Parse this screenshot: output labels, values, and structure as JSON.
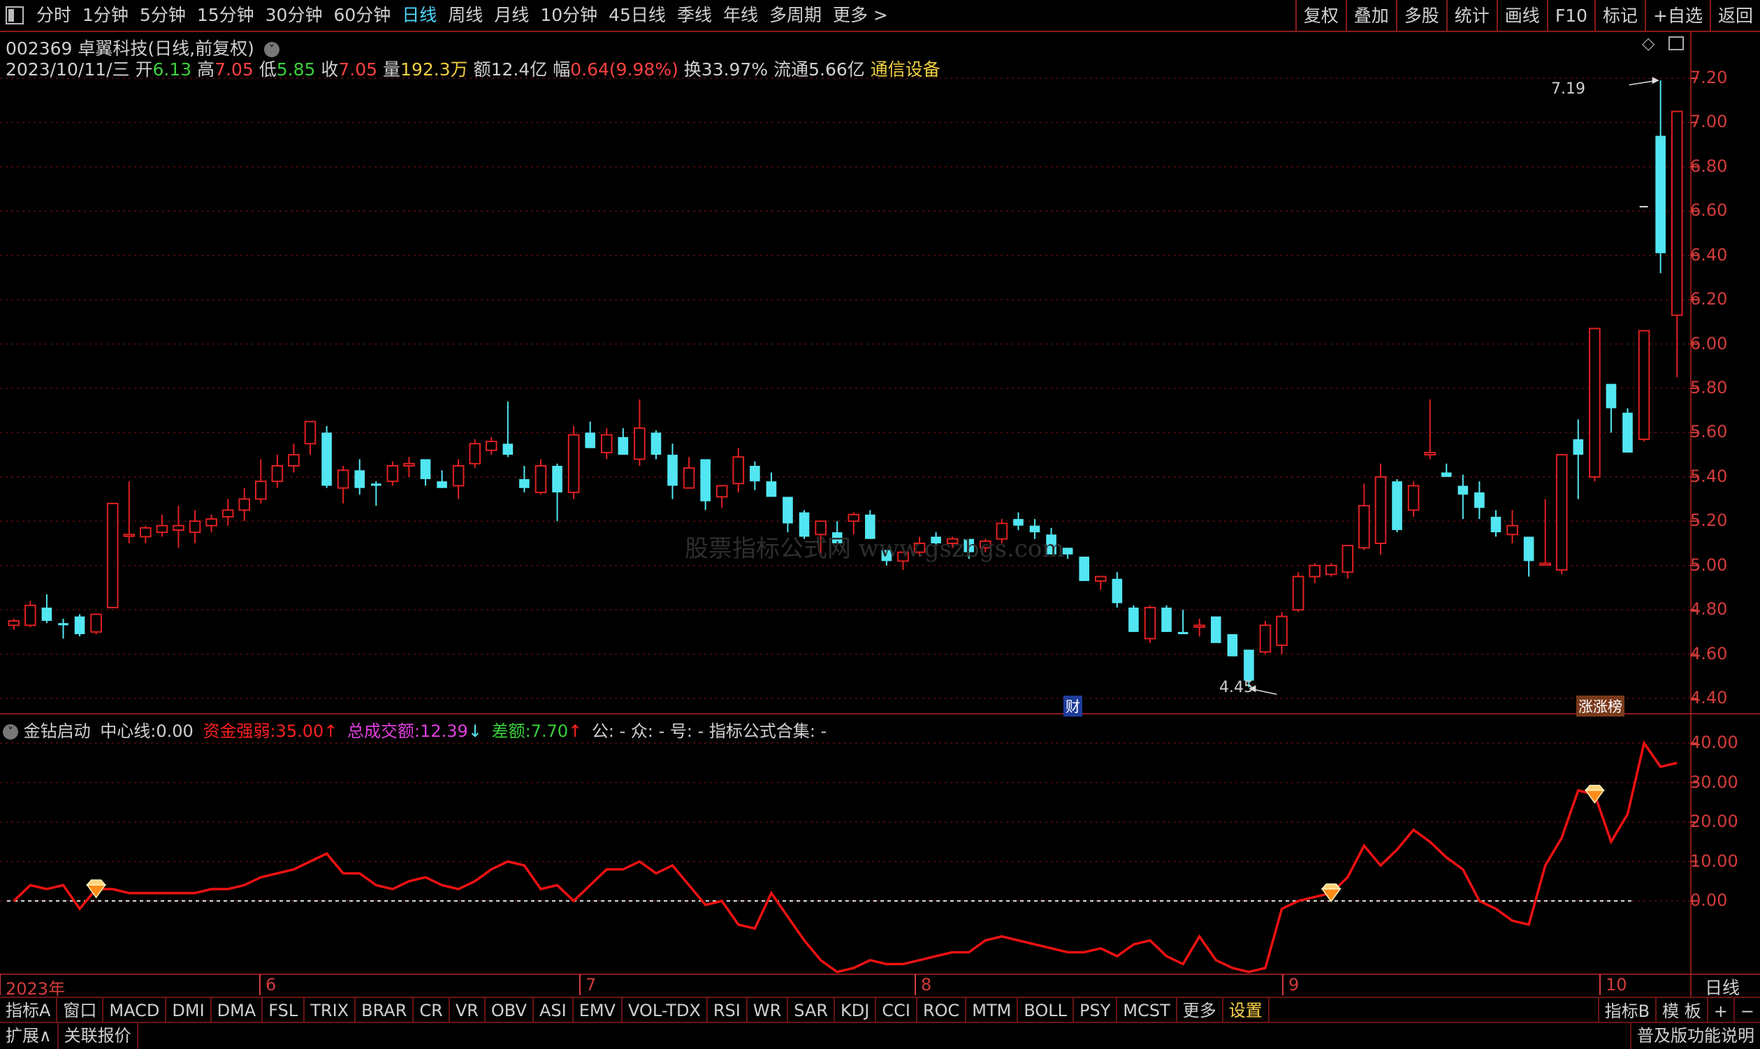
{
  "toolbar": {
    "periods": [
      "分时",
      "1分钟",
      "5分钟",
      "15分钟",
      "30分钟",
      "60分钟",
      "日线",
      "周线",
      "月线",
      "10分钟",
      "45日线",
      "季线",
      "年线",
      "多周期",
      "更多 >"
    ],
    "active": "日线",
    "right": [
      "复权",
      "叠加",
      "多股",
      "统计",
      "画线",
      "F10",
      "标记",
      "+自选",
      "返回"
    ]
  },
  "stock": {
    "title": "002369 卓翼科技(日线,前复权)",
    "date": "2023/10/11/三",
    "open_label": "开",
    "open": "6.13",
    "high_label": "高",
    "high": "7.05",
    "low_label": "低",
    "low": "5.85",
    "close_label": "收",
    "close": "7.05",
    "vol_label": "量",
    "vol": "192.3万",
    "amt_label": "额",
    "amt": "12.4亿",
    "chg_label": "幅",
    "chg": "0.64(9.98%)",
    "turn_label": "换",
    "turn": "33.97%",
    "float_label": "流通",
    "float": "5.66亿",
    "sector": "通信设备"
  },
  "price_axis": [
    "7.20",
    "7.00",
    "6.80",
    "6.60",
    "6.40",
    "6.20",
    "6.00",
    "5.80",
    "5.60",
    "5.40",
    "5.20",
    "5.00",
    "4.80",
    "4.60",
    "4.40"
  ],
  "annotations": {
    "max": "7.19",
    "min": "4.45",
    "cai": "财",
    "badge": "涨涨榜"
  },
  "watermark": "股票指标公式网 www.gszbgs.com",
  "indicator": {
    "name": "金钻启动",
    "center_label": "中心线:",
    "center": "0.00",
    "zjqr_label": "资金强弱:",
    "zjqr": "35.00",
    "zcje_label": "总成交额:",
    "zcje": "12.39",
    "ce_label": "差额:",
    "ce": "7.70",
    "tail": "公: -  众: -  号: -  指标公式合集: -"
  },
  "ind_axis": [
    "40.00",
    "30.00",
    "20.00",
    "10.00",
    "0.00"
  ],
  "time_axis": {
    "labels": [
      "2023年",
      "6",
      "7",
      "8",
      "9",
      "10"
    ],
    "right": "日线"
  },
  "tabs": [
    "指标A",
    "窗口",
    "MACD",
    "DMI",
    "DMA",
    "FSL",
    "TRIX",
    "BRAR",
    "CR",
    "VR",
    "OBV",
    "ASI",
    "EMV",
    "VOL-TDX",
    "RSI",
    "WR",
    "SAR",
    "KDJ",
    "CCI",
    "ROC",
    "MTM",
    "BOLL",
    "PSY",
    "MCST",
    "更多",
    "设置"
  ],
  "tabs_right": [
    "指标B",
    "模 板",
    "+",
    "−"
  ],
  "status": {
    "left": [
      "扩展∧",
      "关联报价"
    ],
    "right": "普及版功能说明"
  },
  "colors": {
    "up": "#e02020",
    "down": "#52e6f2",
    "grid": "#8a1a1a",
    "line": "#ee1111",
    "axis": "#d43b3b"
  },
  "chart_data": [
    {
      "type": "candlestick",
      "ylim": [
        4.4,
        7.2
      ],
      "candles": [
        [
          4.73,
          4.76,
          4.71,
          4.75
        ],
        [
          4.73,
          4.84,
          4.72,
          4.82
        ],
        [
          4.81,
          4.87,
          4.74,
          4.75
        ],
        [
          4.74,
          4.76,
          4.67,
          4.73
        ],
        [
          4.77,
          4.78,
          4.68,
          4.69
        ],
        [
          4.7,
          4.78,
          4.69,
          4.78
        ],
        [
          4.81,
          5.28,
          4.81,
          5.28
        ],
        [
          5.14,
          5.38,
          5.1,
          5.14
        ],
        [
          5.13,
          5.18,
          5.1,
          5.17
        ],
        [
          5.15,
          5.23,
          5.13,
          5.18
        ],
        [
          5.16,
          5.27,
          5.08,
          5.18
        ],
        [
          5.15,
          5.25,
          5.1,
          5.2
        ],
        [
          5.18,
          5.23,
          5.15,
          5.21
        ],
        [
          5.22,
          5.3,
          5.18,
          5.25
        ],
        [
          5.25,
          5.35,
          5.2,
          5.3
        ],
        [
          5.3,
          5.48,
          5.28,
          5.38
        ],
        [
          5.38,
          5.5,
          5.35,
          5.45
        ],
        [
          5.45,
          5.55,
          5.42,
          5.5
        ],
        [
          5.55,
          5.65,
          5.5,
          5.65
        ],
        [
          5.6,
          5.63,
          5.35,
          5.36
        ],
        [
          5.35,
          5.45,
          5.28,
          5.43
        ],
        [
          5.43,
          5.48,
          5.32,
          5.35
        ],
        [
          5.37,
          5.38,
          5.27,
          5.36
        ],
        [
          5.38,
          5.47,
          5.36,
          5.45
        ],
        [
          5.45,
          5.49,
          5.4,
          5.46
        ],
        [
          5.48,
          5.48,
          5.36,
          5.39
        ],
        [
          5.38,
          5.43,
          5.35,
          5.35
        ],
        [
          5.36,
          5.48,
          5.3,
          5.45
        ],
        [
          5.46,
          5.57,
          5.44,
          5.55
        ],
        [
          5.52,
          5.58,
          5.5,
          5.56
        ],
        [
          5.55,
          5.74,
          5.49,
          5.5
        ],
        [
          5.39,
          5.45,
          5.33,
          5.35
        ],
        [
          5.33,
          5.48,
          5.32,
          5.45
        ],
        [
          5.45,
          5.46,
          5.2,
          5.33
        ],
        [
          5.33,
          5.63,
          5.3,
          5.59
        ],
        [
          5.6,
          5.65,
          5.53,
          5.53
        ],
        [
          5.51,
          5.62,
          5.48,
          5.59
        ],
        [
          5.58,
          5.62,
          5.5,
          5.5
        ],
        [
          5.48,
          5.75,
          5.45,
          5.62
        ],
        [
          5.6,
          5.61,
          5.48,
          5.5
        ],
        [
          5.5,
          5.55,
          5.3,
          5.36
        ],
        [
          5.35,
          5.49,
          5.35,
          5.44
        ],
        [
          5.48,
          5.48,
          5.25,
          5.29
        ],
        [
          5.31,
          5.36,
          5.26,
          5.36
        ],
        [
          5.37,
          5.53,
          5.33,
          5.49
        ],
        [
          5.45,
          5.47,
          5.34,
          5.38
        ],
        [
          5.38,
          5.42,
          5.32,
          5.31
        ],
        [
          5.31,
          5.31,
          5.15,
          5.19
        ],
        [
          5.24,
          5.25,
          5.12,
          5.13
        ],
        [
          5.14,
          5.2,
          5.05,
          5.2
        ],
        [
          5.15,
          5.2,
          5.1,
          5.1
        ],
        [
          5.2,
          5.24,
          5.14,
          5.23
        ],
        [
          5.23,
          5.25,
          5.12,
          5.12
        ],
        [
          5.07,
          5.07,
          5.0,
          5.02
        ],
        [
          5.02,
          5.06,
          4.98,
          5.06
        ],
        [
          5.06,
          5.13,
          5.04,
          5.1
        ],
        [
          5.13,
          5.15,
          5.09,
          5.1
        ],
        [
          5.1,
          5.13,
          5.08,
          5.12
        ],
        [
          5.12,
          5.1,
          5.03,
          5.06
        ],
        [
          5.08,
          5.12,
          5.06,
          5.11
        ],
        [
          5.12,
          5.21,
          5.1,
          5.19
        ],
        [
          5.21,
          5.24,
          5.16,
          5.18
        ],
        [
          5.18,
          5.21,
          5.12,
          5.15
        ],
        [
          5.14,
          5.17,
          5.05,
          5.05
        ],
        [
          5.08,
          5.08,
          5.03,
          5.05
        ],
        [
          5.04,
          5.04,
          4.95,
          4.93
        ],
        [
          4.93,
          4.95,
          4.89,
          4.95
        ],
        [
          4.94,
          4.97,
          4.81,
          4.83
        ],
        [
          4.81,
          4.82,
          4.7,
          4.7
        ],
        [
          4.67,
          4.82,
          4.65,
          4.81
        ],
        [
          4.81,
          4.82,
          4.7,
          4.7
        ],
        [
          4.7,
          4.8,
          4.69,
          4.69
        ],
        [
          4.73,
          4.76,
          4.68,
          4.73
        ],
        [
          4.77,
          4.77,
          4.67,
          4.65
        ],
        [
          4.69,
          4.69,
          4.6,
          4.59
        ],
        [
          4.62,
          4.62,
          4.45,
          4.48
        ],
        [
          4.61,
          4.75,
          4.6,
          4.73
        ],
        [
          4.64,
          4.79,
          4.6,
          4.77
        ],
        [
          4.8,
          4.97,
          4.79,
          4.95
        ],
        [
          4.95,
          5.01,
          4.92,
          5.0
        ],
        [
          4.96,
          5.01,
          4.95,
          5.0
        ],
        [
          4.97,
          5.07,
          4.94,
          5.09
        ],
        [
          5.08,
          5.37,
          5.07,
          5.27
        ],
        [
          5.1,
          5.46,
          5.05,
          5.4
        ],
        [
          5.38,
          5.39,
          5.15,
          5.16
        ],
        [
          5.25,
          5.38,
          5.22,
          5.36
        ],
        [
          5.5,
          5.75,
          5.48,
          5.51
        ],
        [
          5.42,
          5.46,
          5.4,
          5.4
        ],
        [
          5.36,
          5.41,
          5.21,
          5.32
        ],
        [
          5.33,
          5.38,
          5.21,
          5.26
        ],
        [
          5.22,
          5.25,
          5.13,
          5.15
        ],
        [
          5.14,
          5.25,
          5.1,
          5.18
        ],
        [
          5.13,
          5.13,
          4.95,
          5.02
        ],
        [
          5.01,
          5.3,
          5.0,
          5.01
        ],
        [
          4.98,
          5.5,
          4.96,
          5.5
        ],
        [
          5.57,
          5.66,
          5.3,
          5.5
        ],
        [
          5.4,
          6.07,
          5.38,
          6.07
        ],
        [
          5.82,
          5.82,
          5.6,
          5.71
        ],
        [
          5.69,
          5.71,
          5.51,
          5.51
        ],
        [
          5.57,
          6.06,
          5.56,
          6.06
        ],
        [
          6.94,
          7.19,
          6.32,
          6.41
        ],
        [
          6.13,
          7.05,
          5.85,
          7.05
        ]
      ]
    },
    {
      "type": "line",
      "name": "资金强弱",
      "ylim": [
        -20,
        42
      ],
      "values": [
        0,
        4,
        3,
        4,
        -2,
        3,
        3,
        2,
        2,
        2,
        2,
        2,
        3,
        3,
        4,
        6,
        7,
        8,
        10,
        12,
        7,
        7,
        4,
        3,
        5,
        6,
        4,
        3,
        5,
        8,
        10,
        9,
        3,
        4,
        0,
        4,
        8,
        8,
        10,
        7,
        9,
        4,
        -1,
        0,
        -6,
        -7,
        2,
        -4,
        -10,
        -15,
        -18,
        -17,
        -15,
        -16,
        -16,
        -15,
        -14,
        -13,
        -13,
        -10,
        -9,
        -10,
        -11,
        -12,
        -13,
        -13,
        -12,
        -14,
        -11,
        -10,
        -14,
        -16,
        -9,
        -15,
        -17,
        -18,
        -17,
        -2,
        0,
        1,
        2,
        6,
        14,
        9,
        13,
        18,
        15,
        11,
        8,
        0,
        -2,
        -5,
        -6,
        9,
        16,
        28,
        27,
        15,
        22,
        40,
        34,
        35
      ],
      "signals": [
        5,
        80,
        96
      ]
    }
  ]
}
